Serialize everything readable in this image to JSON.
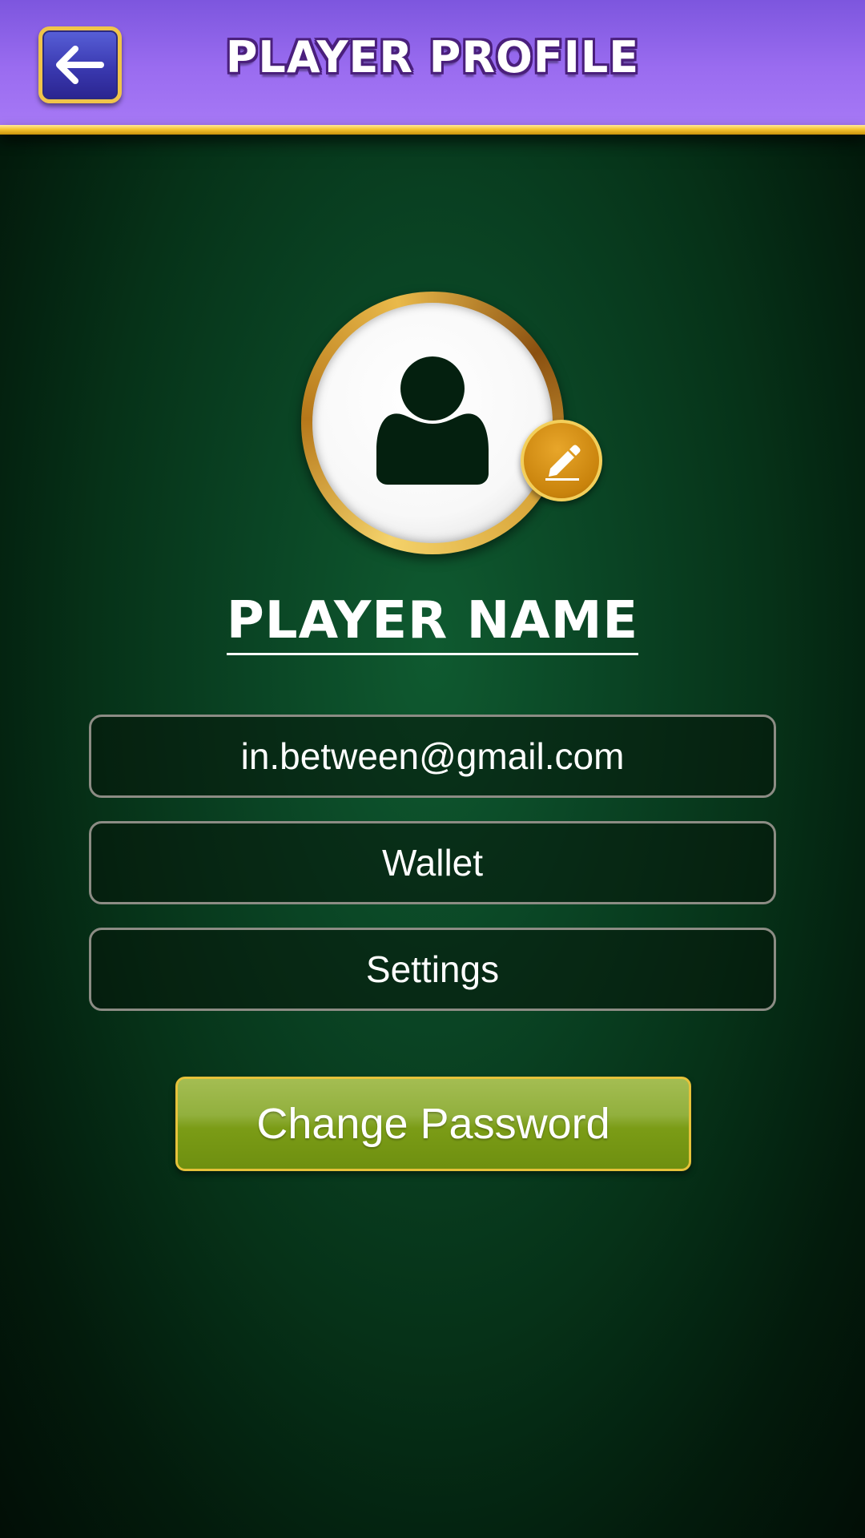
{
  "header": {
    "title": "PLAYER PROFILE",
    "back_icon": "arrow-left-icon"
  },
  "profile": {
    "avatar_icon": "user-silhouette-icon",
    "edit_icon": "pencil-icon",
    "player_name": "PLAYER NAME",
    "email": "in.between@gmail.com"
  },
  "menu": {
    "wallet_label": "Wallet",
    "settings_label": "Settings"
  },
  "actions": {
    "change_password_label": "Change Password"
  },
  "colors": {
    "header_purple": "#9a6cf0",
    "gold_accent": "#f6c431",
    "background_green": "#0a4424",
    "button_green": "#7b9c16"
  }
}
